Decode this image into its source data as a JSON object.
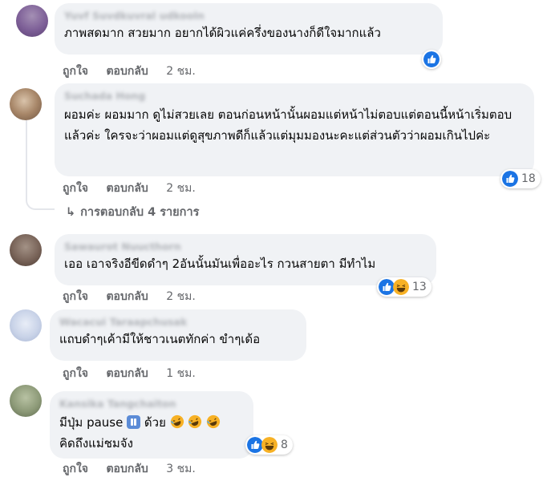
{
  "actions": {
    "like": "ถูกใจ",
    "reply": "ตอบกลับ"
  },
  "colors": {
    "like_blue": "#1b74e4",
    "haha_yellow": "#f7b125",
    "bubble": "#f0f2f5",
    "meta_gray": "#65676b"
  },
  "comments": [
    {
      "author": "Yuvf Suvdkuvral udkooln",
      "text": "ภาพสดมาก สวยมาก อยากได้ผิวแค่ครึ่งของนางก็ดีใจมากแล้ว",
      "time": "2 ชม.",
      "reactions": [
        "like-icon"
      ],
      "reaction_count": ""
    },
    {
      "author": "Suchada Hong",
      "text": "ผอมค่ะ ผอมมาก ดูไม่สวยเลย ตอนก่อนหน้านั้นผอมแต่หน้าไม่ตอบแต่ตอนนี้หน้าเริ่มตอบแล้วค่ะ ใครจะว่าผอมแต่ดูสุขภาพดีก็แล้วแต่มุมมองนะคะแต่ส่วนตัวว่าผอมเกินไปค่ะ",
      "time": "2 ชม.",
      "reactions": [
        "like-icon"
      ],
      "reaction_count": "18",
      "replies_label": "การตอบกลับ 4 รายการ"
    },
    {
      "author": "Sawaurot Nuucthorn",
      "text": "เออ เอาจริงอีขีดดำๆ 2อันนั้นมันเพื่ออะไร กวนสายตา มีทำไม",
      "time": "2 ชม.",
      "reactions": [
        "like-icon",
        "haha-icon"
      ],
      "reaction_count": "13"
    },
    {
      "author": "Wacacui Taraapchusak",
      "text": "แถบดำๆเค้ามีให้ชาวเนตทักค่า ขำๆเด้อ",
      "time": "1 ชม.",
      "reactions": [],
      "reaction_count": ""
    },
    {
      "author": "Kansika Tangchaiton",
      "text_line1_a": "มีปุ่ม pause",
      "text_line1_b": "ด้วย",
      "text_line2": "คิดถึงแม่ชมจัง",
      "time": "3 ชม.",
      "reactions": [
        "like-icon",
        "haha-icon"
      ],
      "reaction_count": "8"
    }
  ]
}
